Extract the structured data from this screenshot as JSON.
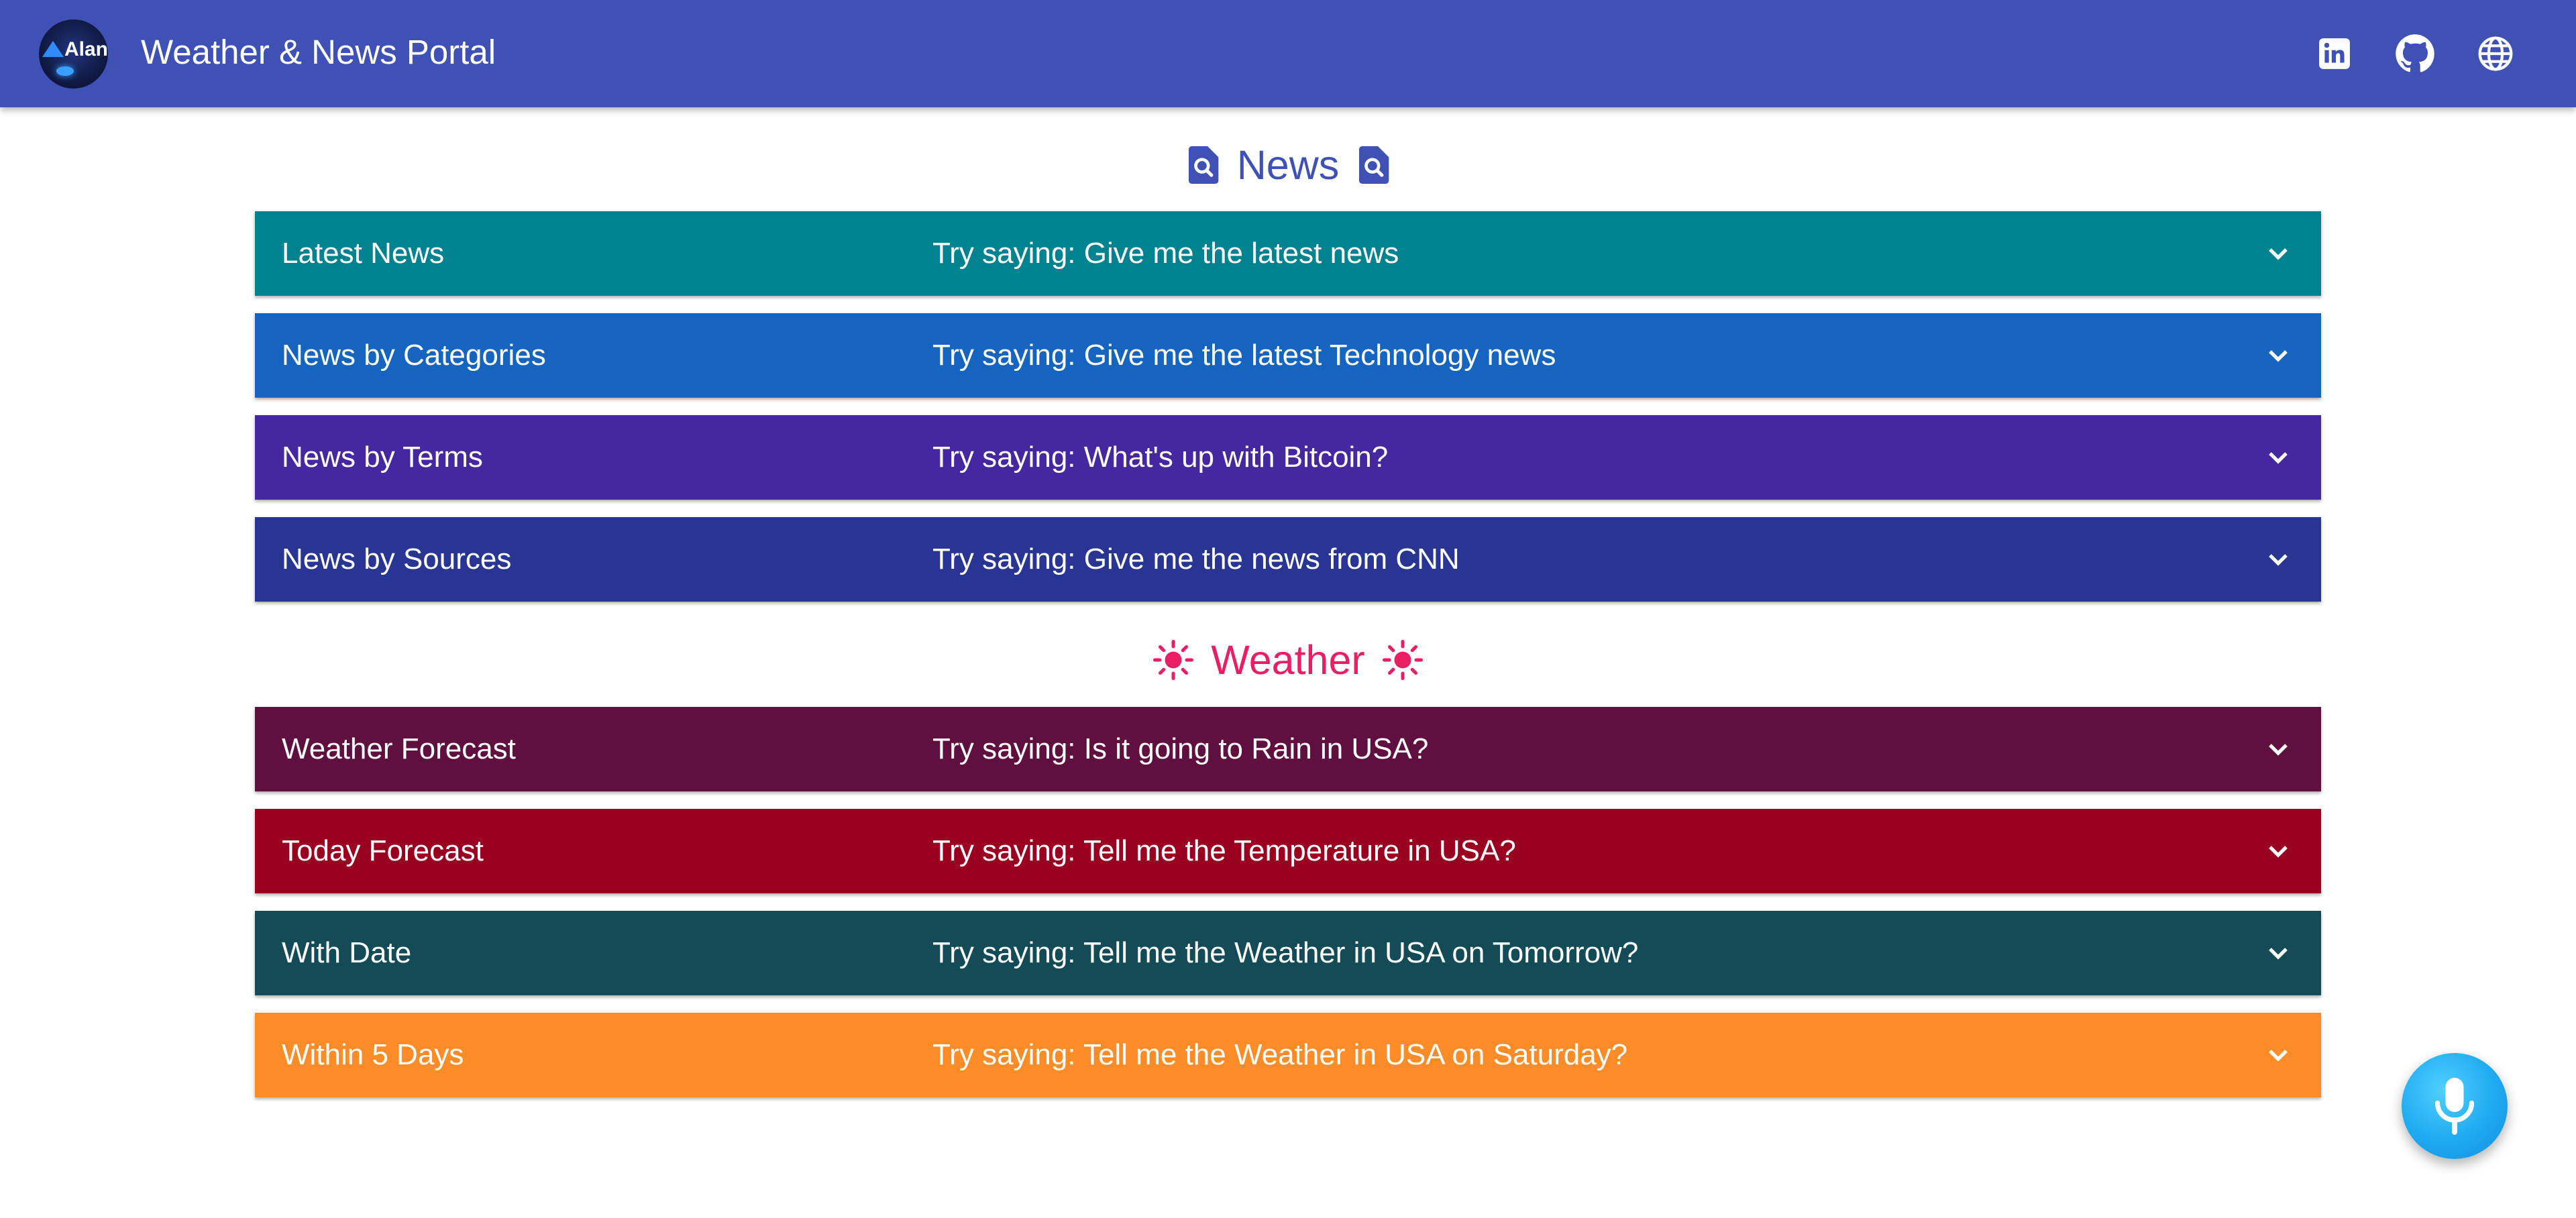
{
  "header": {
    "logo_text": "Alan",
    "title": "Weather & News Portal",
    "icons": [
      "linkedin-icon",
      "github-icon",
      "globe-icon"
    ]
  },
  "news": {
    "title": "News",
    "icon": "search-document-icon",
    "color": "#3f51b5",
    "panels": [
      {
        "label": "Latest News",
        "hint": "Try saying: Give me the latest news",
        "color": "#00838f"
      },
      {
        "label": "News by Categories",
        "hint": "Try saying: Give me the latest Technology news",
        "color": "#1565c0"
      },
      {
        "label": "News by Terms",
        "hint": "Try saying: What's up with Bitcoin?",
        "color": "#4527a0"
      },
      {
        "label": "News by Sources",
        "hint": "Try saying: Give me the news from CNN",
        "color": "#283593"
      }
    ]
  },
  "weather": {
    "title": "Weather",
    "icon": "sun-icon",
    "color": "#e91e63",
    "panels": [
      {
        "label": "Weather Forecast",
        "hint": "Try saying: Is it going to Rain in USA?",
        "color": "#5f103f"
      },
      {
        "label": "Today Forecast",
        "hint": "Try saying: Tell me the Temperature in USA?",
        "color": "#9a0020"
      },
      {
        "label": "With Date",
        "hint": "Try saying: Tell me the Weather in USA on Tomorrow?",
        "color": "#134b56"
      },
      {
        "label": "Within 5 Days",
        "hint": "Try saying: Tell me the Weather in USA on Saturday?",
        "color": "#fb8c28"
      }
    ]
  },
  "fab": {
    "icon": "microphone-icon",
    "color": "#1eaaf1"
  }
}
